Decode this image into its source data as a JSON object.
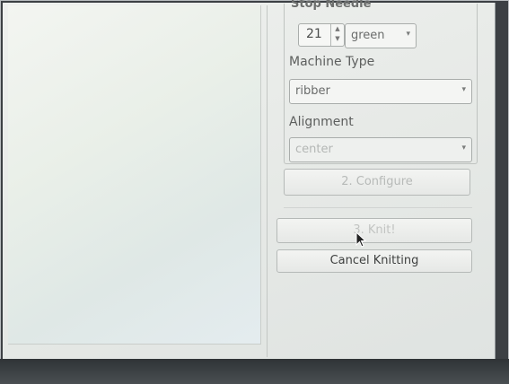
{
  "stop_needle": {
    "label": "Stop Needle",
    "value": "21",
    "color": "green"
  },
  "machine_type": {
    "label": "Machine Type",
    "value": "ribber"
  },
  "alignment": {
    "label": "Alignment",
    "value": "center"
  },
  "buttons": {
    "configure": "2. Configure",
    "knit": "3. Knit!",
    "cancel": "Cancel Knitting"
  }
}
